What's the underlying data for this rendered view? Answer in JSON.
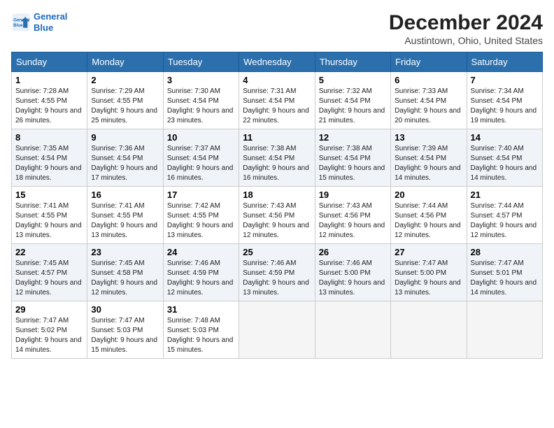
{
  "header": {
    "logo_line1": "General",
    "logo_line2": "Blue",
    "month_title": "December 2024",
    "location": "Austintown, Ohio, United States"
  },
  "weekdays": [
    "Sunday",
    "Monday",
    "Tuesday",
    "Wednesday",
    "Thursday",
    "Friday",
    "Saturday"
  ],
  "weeks": [
    [
      {
        "day": "1",
        "sunrise": "Sunrise: 7:28 AM",
        "sunset": "Sunset: 4:55 PM",
        "daylight": "Daylight: 9 hours and 26 minutes."
      },
      {
        "day": "2",
        "sunrise": "Sunrise: 7:29 AM",
        "sunset": "Sunset: 4:55 PM",
        "daylight": "Daylight: 9 hours and 25 minutes."
      },
      {
        "day": "3",
        "sunrise": "Sunrise: 7:30 AM",
        "sunset": "Sunset: 4:54 PM",
        "daylight": "Daylight: 9 hours and 23 minutes."
      },
      {
        "day": "4",
        "sunrise": "Sunrise: 7:31 AM",
        "sunset": "Sunset: 4:54 PM",
        "daylight": "Daylight: 9 hours and 22 minutes."
      },
      {
        "day": "5",
        "sunrise": "Sunrise: 7:32 AM",
        "sunset": "Sunset: 4:54 PM",
        "daylight": "Daylight: 9 hours and 21 minutes."
      },
      {
        "day": "6",
        "sunrise": "Sunrise: 7:33 AM",
        "sunset": "Sunset: 4:54 PM",
        "daylight": "Daylight: 9 hours and 20 minutes."
      },
      {
        "day": "7",
        "sunrise": "Sunrise: 7:34 AM",
        "sunset": "Sunset: 4:54 PM",
        "daylight": "Daylight: 9 hours and 19 minutes."
      }
    ],
    [
      {
        "day": "8",
        "sunrise": "Sunrise: 7:35 AM",
        "sunset": "Sunset: 4:54 PM",
        "daylight": "Daylight: 9 hours and 18 minutes."
      },
      {
        "day": "9",
        "sunrise": "Sunrise: 7:36 AM",
        "sunset": "Sunset: 4:54 PM",
        "daylight": "Daylight: 9 hours and 17 minutes."
      },
      {
        "day": "10",
        "sunrise": "Sunrise: 7:37 AM",
        "sunset": "Sunset: 4:54 PM",
        "daylight": "Daylight: 9 hours and 16 minutes."
      },
      {
        "day": "11",
        "sunrise": "Sunrise: 7:38 AM",
        "sunset": "Sunset: 4:54 PM",
        "daylight": "Daylight: 9 hours and 16 minutes."
      },
      {
        "day": "12",
        "sunrise": "Sunrise: 7:38 AM",
        "sunset": "Sunset: 4:54 PM",
        "daylight": "Daylight: 9 hours and 15 minutes."
      },
      {
        "day": "13",
        "sunrise": "Sunrise: 7:39 AM",
        "sunset": "Sunset: 4:54 PM",
        "daylight": "Daylight: 9 hours and 14 minutes."
      },
      {
        "day": "14",
        "sunrise": "Sunrise: 7:40 AM",
        "sunset": "Sunset: 4:54 PM",
        "daylight": "Daylight: 9 hours and 14 minutes."
      }
    ],
    [
      {
        "day": "15",
        "sunrise": "Sunrise: 7:41 AM",
        "sunset": "Sunset: 4:55 PM",
        "daylight": "Daylight: 9 hours and 13 minutes."
      },
      {
        "day": "16",
        "sunrise": "Sunrise: 7:41 AM",
        "sunset": "Sunset: 4:55 PM",
        "daylight": "Daylight: 9 hours and 13 minutes."
      },
      {
        "day": "17",
        "sunrise": "Sunrise: 7:42 AM",
        "sunset": "Sunset: 4:55 PM",
        "daylight": "Daylight: 9 hours and 13 minutes."
      },
      {
        "day": "18",
        "sunrise": "Sunrise: 7:43 AM",
        "sunset": "Sunset: 4:56 PM",
        "daylight": "Daylight: 9 hours and 12 minutes."
      },
      {
        "day": "19",
        "sunrise": "Sunrise: 7:43 AM",
        "sunset": "Sunset: 4:56 PM",
        "daylight": "Daylight: 9 hours and 12 minutes."
      },
      {
        "day": "20",
        "sunrise": "Sunrise: 7:44 AM",
        "sunset": "Sunset: 4:56 PM",
        "daylight": "Daylight: 9 hours and 12 minutes."
      },
      {
        "day": "21",
        "sunrise": "Sunrise: 7:44 AM",
        "sunset": "Sunset: 4:57 PM",
        "daylight": "Daylight: 9 hours and 12 minutes."
      }
    ],
    [
      {
        "day": "22",
        "sunrise": "Sunrise: 7:45 AM",
        "sunset": "Sunset: 4:57 PM",
        "daylight": "Daylight: 9 hours and 12 minutes."
      },
      {
        "day": "23",
        "sunrise": "Sunrise: 7:45 AM",
        "sunset": "Sunset: 4:58 PM",
        "daylight": "Daylight: 9 hours and 12 minutes."
      },
      {
        "day": "24",
        "sunrise": "Sunrise: 7:46 AM",
        "sunset": "Sunset: 4:59 PM",
        "daylight": "Daylight: 9 hours and 12 minutes."
      },
      {
        "day": "25",
        "sunrise": "Sunrise: 7:46 AM",
        "sunset": "Sunset: 4:59 PM",
        "daylight": "Daylight: 9 hours and 13 minutes."
      },
      {
        "day": "26",
        "sunrise": "Sunrise: 7:46 AM",
        "sunset": "Sunset: 5:00 PM",
        "daylight": "Daylight: 9 hours and 13 minutes."
      },
      {
        "day": "27",
        "sunrise": "Sunrise: 7:47 AM",
        "sunset": "Sunset: 5:00 PM",
        "daylight": "Daylight: 9 hours and 13 minutes."
      },
      {
        "day": "28",
        "sunrise": "Sunrise: 7:47 AM",
        "sunset": "Sunset: 5:01 PM",
        "daylight": "Daylight: 9 hours and 14 minutes."
      }
    ],
    [
      {
        "day": "29",
        "sunrise": "Sunrise: 7:47 AM",
        "sunset": "Sunset: 5:02 PM",
        "daylight": "Daylight: 9 hours and 14 minutes."
      },
      {
        "day": "30",
        "sunrise": "Sunrise: 7:47 AM",
        "sunset": "Sunset: 5:03 PM",
        "daylight": "Daylight: 9 hours and 15 minutes."
      },
      {
        "day": "31",
        "sunrise": "Sunrise: 7:48 AM",
        "sunset": "Sunset: 5:03 PM",
        "daylight": "Daylight: 9 hours and 15 minutes."
      },
      null,
      null,
      null,
      null
    ]
  ]
}
